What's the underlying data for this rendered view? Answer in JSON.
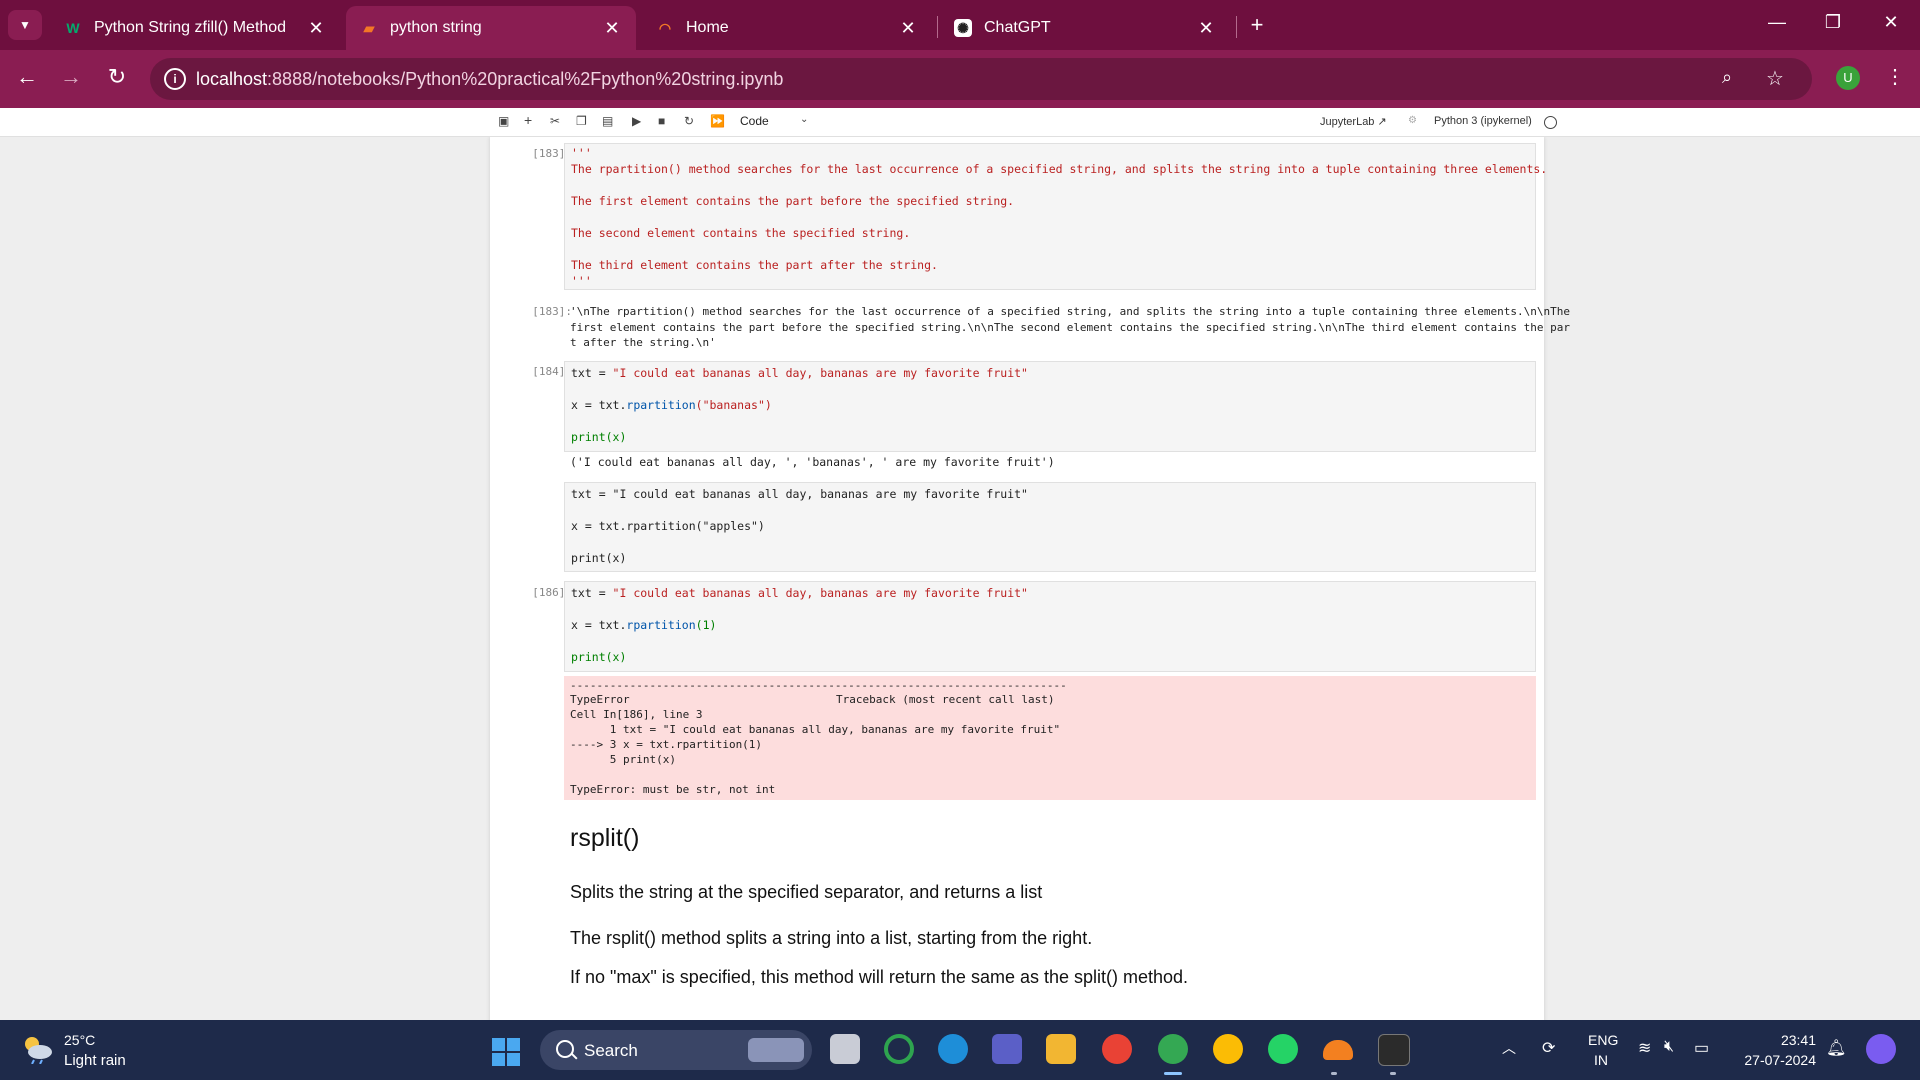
{
  "browser": {
    "tabs": [
      {
        "title": "Python String zfill() Method",
        "favicon": "w3schools-icon",
        "active": false
      },
      {
        "title": "python string",
        "favicon": "notebook-icon",
        "active": true
      },
      {
        "title": "Home",
        "favicon": "home-spinner-icon",
        "active": false
      },
      {
        "title": "ChatGPT",
        "favicon": "chatgpt-icon",
        "active": false
      }
    ],
    "url_host": "localhost",
    "url_path": ":8888/notebooks/Python%20practical%2Fpython%20string.ipynb",
    "profile_initial": "U",
    "colors": {
      "tabbar": "#6e0f3e",
      "toolbar": "#8a1d52"
    }
  },
  "notebook": {
    "cell_type": "Code",
    "jupyterlab_link": "JupyterLab",
    "kernel": "Python 3 (ipykernel)",
    "cells": {
      "c183_in": {
        "prompt": "[183]:",
        "lines": [
          "'''",
          "The rpartition() method searches for the last occurrence of a specified string, and splits the string into a tuple containing three elements.",
          "The first element contains the part before the specified string.",
          "The second element contains the specified string.",
          "The third element contains the part after the string.",
          "'''"
        ]
      },
      "c183_out": {
        "prompt": "[183]:",
        "lines": [
          "'\\nThe rpartition() method searches for the last occurrence of a specified string, and splits the string into a tuple containing three elements.\\n\\nThe",
          "first element contains the part before the specified string.\\n\\nThe second element contains the specified string.\\n\\nThe third element contains the par",
          "t after the string.\\n'"
        ]
      },
      "c184_in": {
        "prompt": "[184]:",
        "line1_var": "txt = ",
        "line1_str": "\"I could eat bananas all day, bananas are my favorite fruit\"",
        "line2_pre": "x = txt.",
        "line2_method": "rpartition",
        "line2_arg": "(\"bananas\")",
        "line3": "print(x)"
      },
      "c184_out": "('I could eat bananas all day, ', 'bananas', ' are my favorite fruit')",
      "c185_in": {
        "line1": "txt = \"I could eat bananas all day, bananas are my favorite fruit\"",
        "line2": "x = txt.rpartition(\"apples\")",
        "line3": "print(x)"
      },
      "c186_in": {
        "prompt": "[186]:",
        "line1_var": "txt = ",
        "line1_str": "\"I could eat bananas all day, bananas are my favorite fruit\"",
        "line2_pre": "x = txt.",
        "line2_method": "rpartition",
        "line2_arg": "(1)",
        "line3": "print(x)"
      },
      "c186_err": {
        "rule": "---------------------------------------------------------------------------",
        "type": "TypeError",
        "traceback": "Traceback (most recent call last)",
        "cell": "Cell In[186], line 3",
        "l1": "      1 txt = \"I could eat bananas all day, bananas are my favorite fruit\"",
        "l2": "----> 3 x = txt.rpartition(1)",
        "l3": "      5 print(x)",
        "msg": "TypeError: must be str, not int"
      }
    },
    "markdown": {
      "heading": "rsplit()",
      "p1": "Splits the string at the specified separator, and returns a list",
      "p2": "The rsplit() method splits a string into a list, starting from the right.",
      "p3": "If no \"max\" is specified, this method will return the same as the split() method."
    }
  },
  "taskbar": {
    "temperature": "25°C",
    "weather": "Light rain",
    "search_label": "Search",
    "lang1": "ENG",
    "lang2": "IN",
    "time": "23:41",
    "date": "27-07-2024"
  }
}
